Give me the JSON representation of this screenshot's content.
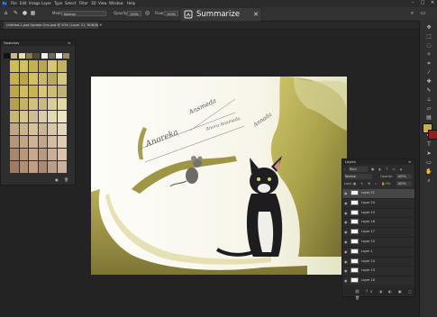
{
  "menubar": {
    "items": [
      "File",
      "Edit",
      "Image",
      "Layer",
      "Type",
      "Select",
      "Filter",
      "3D",
      "View",
      "Window",
      "Help"
    ]
  },
  "options": {
    "mode_label": "Mode:",
    "mode_value": "Normal",
    "opacity_label": "Opacity:",
    "opacity_value": "100%",
    "flow_label": "Flow:",
    "flow_value": "100%"
  },
  "summarize": {
    "label": "Summarize"
  },
  "document_tab": {
    "title": "Untitled-1.psd Update Ons.psd @ 50% (Layer 21, RGB/8)"
  },
  "swatches": {
    "title": "Swatches",
    "top_row": [
      "#111111",
      "#c9b88d",
      "#e6dcb6",
      "#8a7a4a",
      "#4d4a35",
      "#f4f1e6",
      "#6e6b5c",
      "#ffffff",
      "#9a8e62"
    ],
    "grid": [
      [
        "#cdbd55",
        "#d3c160",
        "#c4b24f",
        "#b9a748",
        "#d7c86a",
        "#c2b45d"
      ],
      [
        "#c7b24a",
        "#bba546",
        "#d2c161",
        "#c9b85f",
        "#b8a95c",
        "#d6c97b"
      ],
      [
        "#bfa844",
        "#d1bd59",
        "#c9b54e",
        "#d8c76e",
        "#ccbd72",
        "#bfb37a"
      ],
      [
        "#b5a24b",
        "#c7b363",
        "#d2c17a",
        "#c8bb80",
        "#d9ce97",
        "#e2d7a6"
      ],
      [
        "#c9b577",
        "#d6c68e",
        "#cdbd91",
        "#d9cda4",
        "#e3d8b5",
        "#ede4c6"
      ],
      [
        "#bfa87d",
        "#cbb48c",
        "#d7c29e",
        "#c9b496",
        "#d8c6ab",
        "#e4d6bf"
      ],
      [
        "#b59677",
        "#c3a586",
        "#cfb395",
        "#c2a58c",
        "#d4bba3",
        "#e0cbb6"
      ],
      [
        "#a8876a",
        "#b9987a",
        "#c8a88a",
        "#b89a83",
        "#caae98",
        "#d9c2ae"
      ],
      [
        "#9d7c62",
        "#b08f73",
        "#c09f84",
        "#a98b74",
        "#bb9e88",
        "#cbb19d"
      ]
    ]
  },
  "canvas": {
    "signatures": [
      "Anoreka",
      "Ansmeda",
      "Anora Ansmeda",
      "Annada"
    ],
    "watermark": "Anora Ansmeda"
  },
  "layers": {
    "title": "Layers",
    "filter_label": "Kind",
    "blend_mode": "Normal",
    "opacity_label": "Opacity:",
    "opacity_value": "100%",
    "lock_label": "Lock:",
    "fill_label": "Fill:",
    "fill_value": "100%",
    "items": [
      "Layer 21",
      "Layer 20",
      "Layer 19",
      "Layer 18",
      "Layer 17",
      "Layer 15",
      "Layer 1",
      "Layer 14",
      "Layer 13",
      "Layer 16"
    ]
  },
  "colors": {
    "foreground": "#c9b04a",
    "background": "#8e1f1f"
  }
}
